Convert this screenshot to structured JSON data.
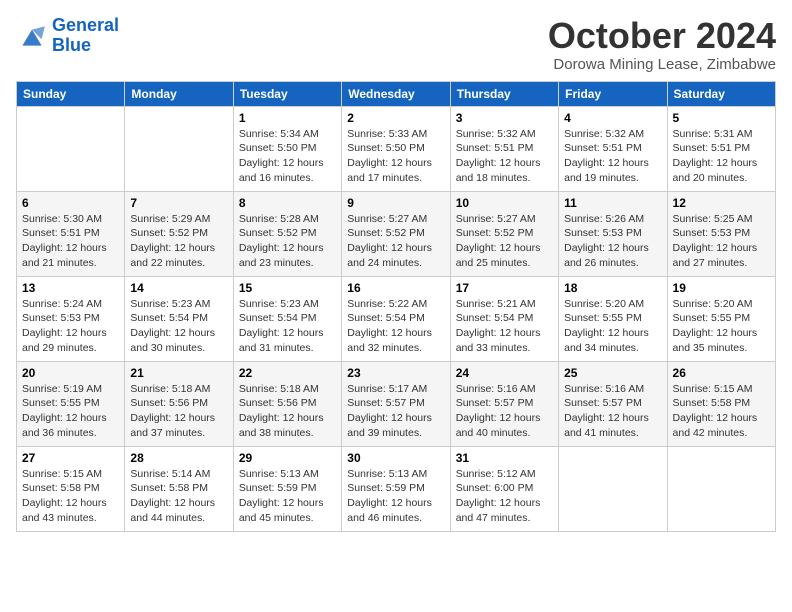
{
  "header": {
    "logo_line1": "General",
    "logo_line2": "Blue",
    "month": "October 2024",
    "location": "Dorowa Mining Lease, Zimbabwe"
  },
  "days_of_week": [
    "Sunday",
    "Monday",
    "Tuesday",
    "Wednesday",
    "Thursday",
    "Friday",
    "Saturday"
  ],
  "weeks": [
    [
      {
        "day": "",
        "info": ""
      },
      {
        "day": "",
        "info": ""
      },
      {
        "day": "1",
        "info": "Sunrise: 5:34 AM\nSunset: 5:50 PM\nDaylight: 12 hours and 16 minutes."
      },
      {
        "day": "2",
        "info": "Sunrise: 5:33 AM\nSunset: 5:50 PM\nDaylight: 12 hours and 17 minutes."
      },
      {
        "day": "3",
        "info": "Sunrise: 5:32 AM\nSunset: 5:51 PM\nDaylight: 12 hours and 18 minutes."
      },
      {
        "day": "4",
        "info": "Sunrise: 5:32 AM\nSunset: 5:51 PM\nDaylight: 12 hours and 19 minutes."
      },
      {
        "day": "5",
        "info": "Sunrise: 5:31 AM\nSunset: 5:51 PM\nDaylight: 12 hours and 20 minutes."
      }
    ],
    [
      {
        "day": "6",
        "info": "Sunrise: 5:30 AM\nSunset: 5:51 PM\nDaylight: 12 hours and 21 minutes."
      },
      {
        "day": "7",
        "info": "Sunrise: 5:29 AM\nSunset: 5:52 PM\nDaylight: 12 hours and 22 minutes."
      },
      {
        "day": "8",
        "info": "Sunrise: 5:28 AM\nSunset: 5:52 PM\nDaylight: 12 hours and 23 minutes."
      },
      {
        "day": "9",
        "info": "Sunrise: 5:27 AM\nSunset: 5:52 PM\nDaylight: 12 hours and 24 minutes."
      },
      {
        "day": "10",
        "info": "Sunrise: 5:27 AM\nSunset: 5:52 PM\nDaylight: 12 hours and 25 minutes."
      },
      {
        "day": "11",
        "info": "Sunrise: 5:26 AM\nSunset: 5:53 PM\nDaylight: 12 hours and 26 minutes."
      },
      {
        "day": "12",
        "info": "Sunrise: 5:25 AM\nSunset: 5:53 PM\nDaylight: 12 hours and 27 minutes."
      }
    ],
    [
      {
        "day": "13",
        "info": "Sunrise: 5:24 AM\nSunset: 5:53 PM\nDaylight: 12 hours and 29 minutes."
      },
      {
        "day": "14",
        "info": "Sunrise: 5:23 AM\nSunset: 5:54 PM\nDaylight: 12 hours and 30 minutes."
      },
      {
        "day": "15",
        "info": "Sunrise: 5:23 AM\nSunset: 5:54 PM\nDaylight: 12 hours and 31 minutes."
      },
      {
        "day": "16",
        "info": "Sunrise: 5:22 AM\nSunset: 5:54 PM\nDaylight: 12 hours and 32 minutes."
      },
      {
        "day": "17",
        "info": "Sunrise: 5:21 AM\nSunset: 5:54 PM\nDaylight: 12 hours and 33 minutes."
      },
      {
        "day": "18",
        "info": "Sunrise: 5:20 AM\nSunset: 5:55 PM\nDaylight: 12 hours and 34 minutes."
      },
      {
        "day": "19",
        "info": "Sunrise: 5:20 AM\nSunset: 5:55 PM\nDaylight: 12 hours and 35 minutes."
      }
    ],
    [
      {
        "day": "20",
        "info": "Sunrise: 5:19 AM\nSunset: 5:55 PM\nDaylight: 12 hours and 36 minutes."
      },
      {
        "day": "21",
        "info": "Sunrise: 5:18 AM\nSunset: 5:56 PM\nDaylight: 12 hours and 37 minutes."
      },
      {
        "day": "22",
        "info": "Sunrise: 5:18 AM\nSunset: 5:56 PM\nDaylight: 12 hours and 38 minutes."
      },
      {
        "day": "23",
        "info": "Sunrise: 5:17 AM\nSunset: 5:57 PM\nDaylight: 12 hours and 39 minutes."
      },
      {
        "day": "24",
        "info": "Sunrise: 5:16 AM\nSunset: 5:57 PM\nDaylight: 12 hours and 40 minutes."
      },
      {
        "day": "25",
        "info": "Sunrise: 5:16 AM\nSunset: 5:57 PM\nDaylight: 12 hours and 41 minutes."
      },
      {
        "day": "26",
        "info": "Sunrise: 5:15 AM\nSunset: 5:58 PM\nDaylight: 12 hours and 42 minutes."
      }
    ],
    [
      {
        "day": "27",
        "info": "Sunrise: 5:15 AM\nSunset: 5:58 PM\nDaylight: 12 hours and 43 minutes."
      },
      {
        "day": "28",
        "info": "Sunrise: 5:14 AM\nSunset: 5:58 PM\nDaylight: 12 hours and 44 minutes."
      },
      {
        "day": "29",
        "info": "Sunrise: 5:13 AM\nSunset: 5:59 PM\nDaylight: 12 hours and 45 minutes."
      },
      {
        "day": "30",
        "info": "Sunrise: 5:13 AM\nSunset: 5:59 PM\nDaylight: 12 hours and 46 minutes."
      },
      {
        "day": "31",
        "info": "Sunrise: 5:12 AM\nSunset: 6:00 PM\nDaylight: 12 hours and 47 minutes."
      },
      {
        "day": "",
        "info": ""
      },
      {
        "day": "",
        "info": ""
      }
    ]
  ]
}
